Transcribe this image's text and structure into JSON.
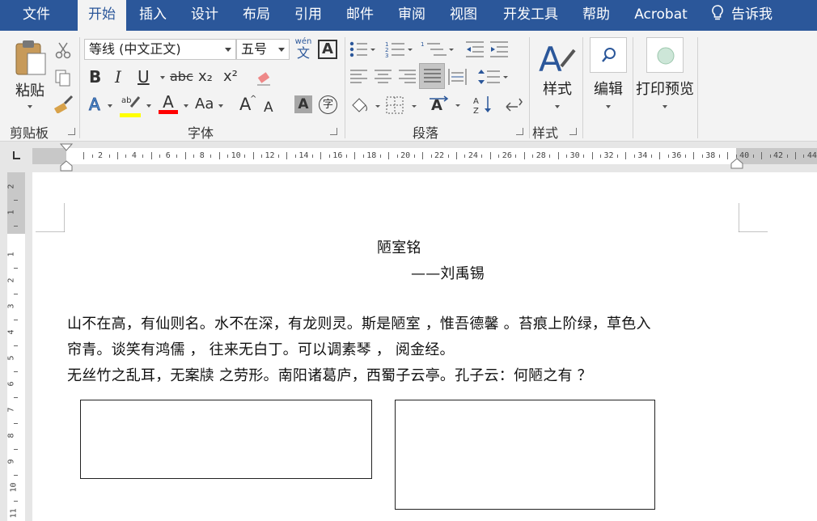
{
  "tabs": [
    {
      "label": "文件",
      "active": false
    },
    {
      "label": "开始",
      "active": true
    },
    {
      "label": "插入",
      "active": false
    },
    {
      "label": "设计",
      "active": false
    },
    {
      "label": "布局",
      "active": false
    },
    {
      "label": "引用",
      "active": false
    },
    {
      "label": "邮件",
      "active": false
    },
    {
      "label": "审阅",
      "active": false
    },
    {
      "label": "视图",
      "active": false
    },
    {
      "label": "开发工具",
      "active": false
    },
    {
      "label": "帮助",
      "active": false
    },
    {
      "label": "Acrobat",
      "active": false
    }
  ],
  "tell_me": "告诉我",
  "ribbon": {
    "clipboard": {
      "paste_label": "粘贴",
      "group_label": "剪贴板"
    },
    "font": {
      "font_name": "等线 (中文正文)",
      "font_size": "五号",
      "wen": "wén",
      "wen_char": "文",
      "group_label": "字体",
      "bold": "B",
      "italic": "I",
      "underline": "U",
      "strike": "abc",
      "sub": "x₂",
      "sup": "x²",
      "aa": "Aa",
      "grow": "A",
      "shrink": "A",
      "charbox": "A",
      "enclose": "字"
    },
    "paragraph": {
      "group_label": "段落"
    },
    "styles": {
      "label": "样式",
      "group_label": "样式"
    },
    "editing": {
      "label": "编辑"
    },
    "print": {
      "label": "打印预览"
    }
  },
  "colors": {
    "brand": "#2b579a",
    "highlight": "#ffff00",
    "font_red": "#ff0000"
  },
  "hruler_ticks": [
    "2",
    "4",
    "6",
    "8",
    "10",
    "12",
    "14",
    "16",
    "18",
    "20",
    "22",
    "24",
    "26",
    "28",
    "30",
    "32",
    "34",
    "36",
    "38",
    "40",
    "42",
    "44"
  ],
  "vruler_ticks": [
    "2",
    "1",
    "1",
    "2",
    "3",
    "4",
    "5",
    "6",
    "7",
    "8",
    "9",
    "10",
    "11"
  ],
  "document": {
    "title": "陋室铭",
    "author": "——刘禹锡",
    "lines": [
      "山不在高，有仙则名。水不在深，有龙则灵。斯是陋室 ，惟吾德馨 。苔痕上阶绿，草色入",
      "帘青。谈笑有鸿儒 ， 往来无白丁。可以调素琴 ， 阅金经。",
      "无丝竹之乱耳，无案牍 之劳形。南阳诸葛庐，西蜀子云亭。孔子云：何陋之有 ？"
    ]
  }
}
